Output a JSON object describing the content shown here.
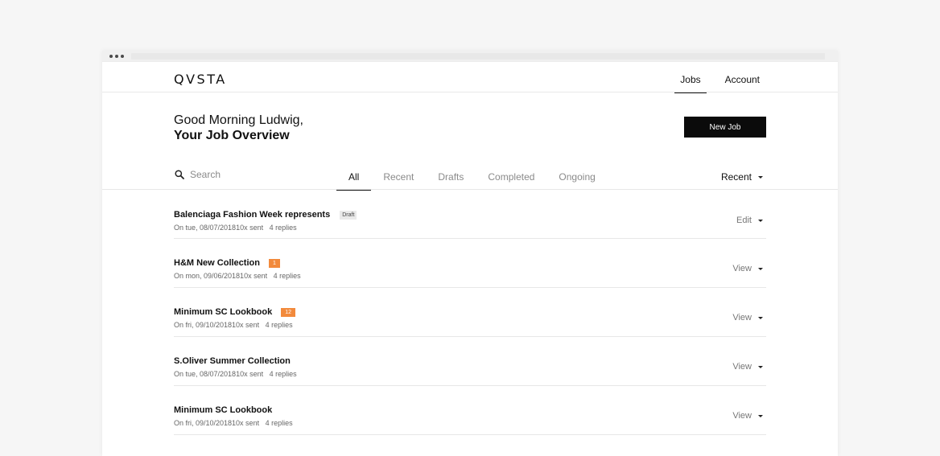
{
  "brand": {
    "logo_text": "QVSTA"
  },
  "nav": {
    "items": [
      {
        "label": "Jobs",
        "active": true
      },
      {
        "label": "Account",
        "active": false
      }
    ]
  },
  "hero": {
    "greeting_line1": "Good Morning Ludwig,",
    "greeting_line2": "Your Job Overview",
    "new_job_label": "New Job"
  },
  "filter": {
    "search_placeholder": "Search",
    "tabs": [
      {
        "label": "All",
        "active": true
      },
      {
        "label": "Recent",
        "active": false
      },
      {
        "label": "Drafts",
        "active": false
      },
      {
        "label": "Completed",
        "active": false
      },
      {
        "label": "Ongoing",
        "active": false
      }
    ],
    "sort_label": "Recent"
  },
  "jobs": [
    {
      "title": "Balenciaga Fashion Week represents",
      "badge": "Draft",
      "badge_type": "draft",
      "date_text": "On tue, 08/07/201810x sent",
      "replies": "4 replies",
      "action": "Edit"
    },
    {
      "title": "H&M New Collection",
      "badge": "1",
      "badge_type": "count",
      "date_text": "On mon, 09/06/201810x sent",
      "replies": "4 replies",
      "action": "View"
    },
    {
      "title": "Minimum SC Lookbook",
      "badge": "12",
      "badge_type": "count",
      "date_text": "On fri, 09/10/201810x sent",
      "replies": "4 replies",
      "action": "View"
    },
    {
      "title": "S.Oliver Summer Collection",
      "badge": "",
      "badge_type": "none",
      "date_text": "On tue, 08/07/201810x sent",
      "replies": "4 replies",
      "action": "View"
    },
    {
      "title": "Minimum SC Lookbook",
      "badge": "",
      "badge_type": "none",
      "date_text": "On fri, 09/10/201810x sent",
      "replies": "4 replies",
      "action": "View"
    }
  ],
  "colors": {
    "accent_badge": "#f28a3c",
    "button_bg": "#0b0b0b",
    "draft_badge_bg": "#e9e9e9"
  },
  "icons": {
    "search": "search-icon",
    "caret": "chevron-down-icon"
  }
}
